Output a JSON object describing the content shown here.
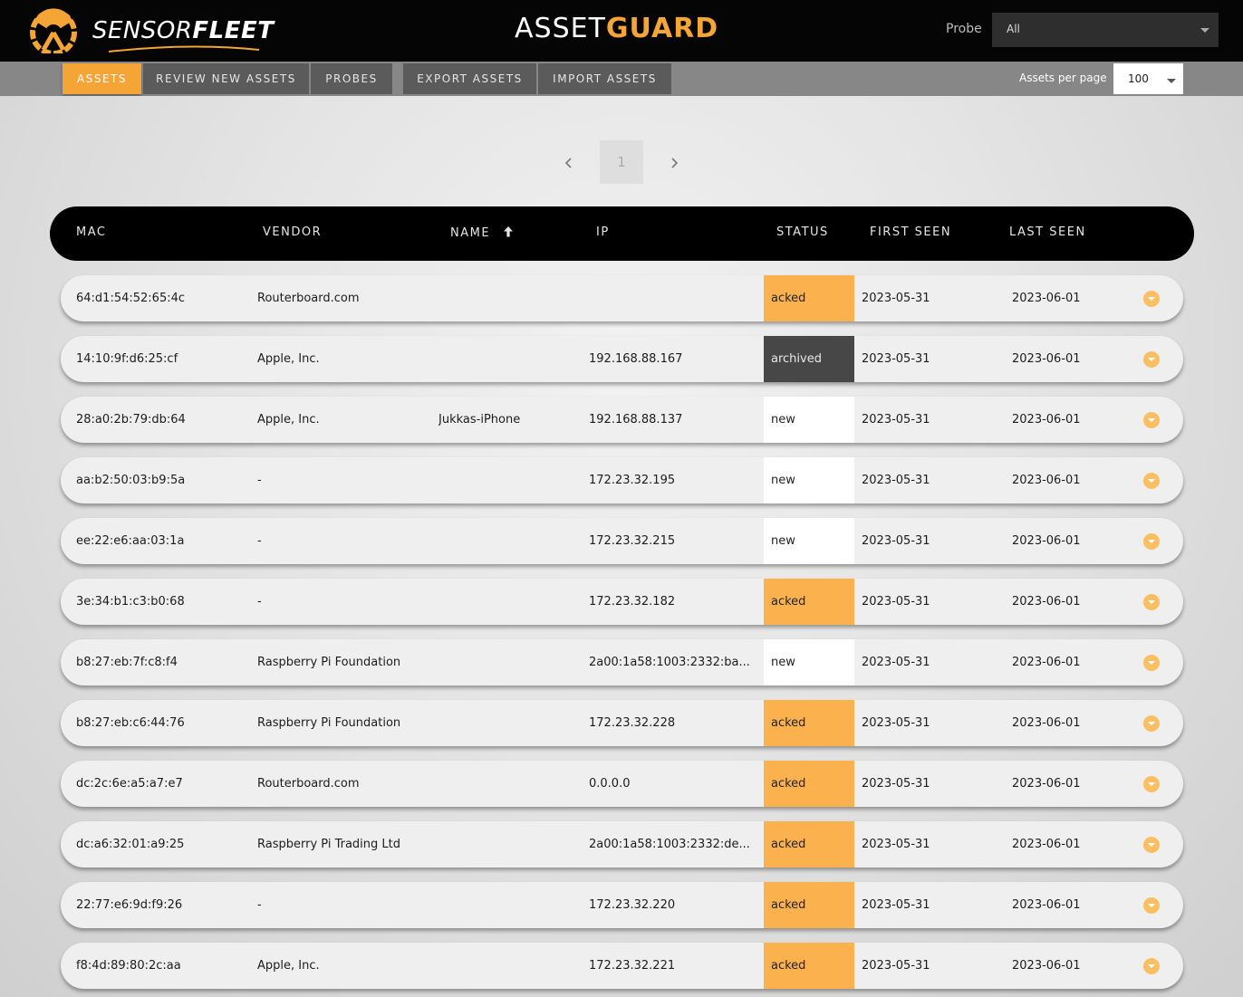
{
  "brand": {
    "logo_text_light": "SENSOR",
    "logo_text_bold": "FLEET",
    "app_title_light": "ASSET",
    "app_title_bold": "GUARD",
    "accent": "#f4a535"
  },
  "probe": {
    "label": "Probe",
    "selected": "All"
  },
  "nav": {
    "tabs": [
      {
        "label": "ASSETS",
        "active": true
      },
      {
        "label": "REVIEW NEW ASSETS",
        "active": false
      },
      {
        "label": "PROBES",
        "active": false
      },
      {
        "label": "EXPORT ASSETS",
        "active": false
      },
      {
        "label": "IMPORT ASSETS",
        "active": false
      }
    ],
    "per_page_label": "Assets per page",
    "per_page_value": "100"
  },
  "pager": {
    "prev_icon": "chevron-left-icon",
    "current_page": "1",
    "next_icon": "chevron-right-icon"
  },
  "table": {
    "headers": {
      "mac": "MAC",
      "vendor": "VENDOR",
      "name": "NAME",
      "ip": "IP",
      "status": "STATUS",
      "first_seen": "FIRST SEEN",
      "last_seen": "LAST SEEN"
    },
    "sort_icon": "arrow-up-icon",
    "rows": [
      {
        "mac": "64:d1:54:52:65:4c",
        "vendor": "Routerboard.com",
        "name": "",
        "ip": "",
        "status": "acked",
        "first_seen": "2023-05-31",
        "last_seen": "2023-06-01"
      },
      {
        "mac": "14:10:9f:d6:25:cf",
        "vendor": "Apple, Inc.",
        "name": "",
        "ip": "192.168.88.167",
        "status": "archived",
        "first_seen": "2023-05-31",
        "last_seen": "2023-06-01"
      },
      {
        "mac": "28:a0:2b:79:db:64",
        "vendor": "Apple, Inc.",
        "name": "Jukkas-iPhone",
        "ip": "192.168.88.137",
        "status": "new",
        "first_seen": "2023-05-31",
        "last_seen": "2023-06-01"
      },
      {
        "mac": "aa:b2:50:03:b9:5a",
        "vendor": "-",
        "name": "",
        "ip": "172.23.32.195",
        "status": "new",
        "first_seen": "2023-05-31",
        "last_seen": "2023-06-01"
      },
      {
        "mac": "ee:22:e6:aa:03:1a",
        "vendor": "-",
        "name": "",
        "ip": "172.23.32.215",
        "status": "new",
        "first_seen": "2023-05-31",
        "last_seen": "2023-06-01"
      },
      {
        "mac": "3e:34:b1:c3:b0:68",
        "vendor": "-",
        "name": "",
        "ip": "172.23.32.182",
        "status": "acked",
        "first_seen": "2023-05-31",
        "last_seen": "2023-06-01"
      },
      {
        "mac": "b8:27:eb:7f:c8:f4",
        "vendor": "Raspberry Pi Foundation",
        "name": "",
        "ip": "2a00:1a58:1003:2332:ba...",
        "status": "new",
        "first_seen": "2023-05-31",
        "last_seen": "2023-06-01"
      },
      {
        "mac": "b8:27:eb:c6:44:76",
        "vendor": "Raspberry Pi Foundation",
        "name": "",
        "ip": "172.23.32.228",
        "status": "acked",
        "first_seen": "2023-05-31",
        "last_seen": "2023-06-01"
      },
      {
        "mac": "dc:2c:6e:a5:a7:e7",
        "vendor": "Routerboard.com",
        "name": "",
        "ip": "0.0.0.0",
        "status": "acked",
        "first_seen": "2023-05-31",
        "last_seen": "2023-06-01"
      },
      {
        "mac": "dc:a6:32:01:a9:25",
        "vendor": "Raspberry Pi Trading Ltd",
        "name": "",
        "ip": "2a00:1a58:1003:2332:de...",
        "status": "acked",
        "first_seen": "2023-05-31",
        "last_seen": "2023-06-01"
      },
      {
        "mac": "22:77:e6:9d:f9:26",
        "vendor": "-",
        "name": "",
        "ip": "172.23.32.220",
        "status": "acked",
        "first_seen": "2023-05-31",
        "last_seen": "2023-06-01"
      },
      {
        "mac": "f8:4d:89:80:2c:aa",
        "vendor": "Apple, Inc.",
        "name": "",
        "ip": "172.23.32.221",
        "status": "acked",
        "first_seen": "2023-05-31",
        "last_seen": "2023-06-01"
      }
    ],
    "row_action_icon": "chevron-down-circle-icon",
    "status_colors": {
      "acked": "#fbb24e",
      "archived": "#474747",
      "new": "#ffffff"
    }
  }
}
